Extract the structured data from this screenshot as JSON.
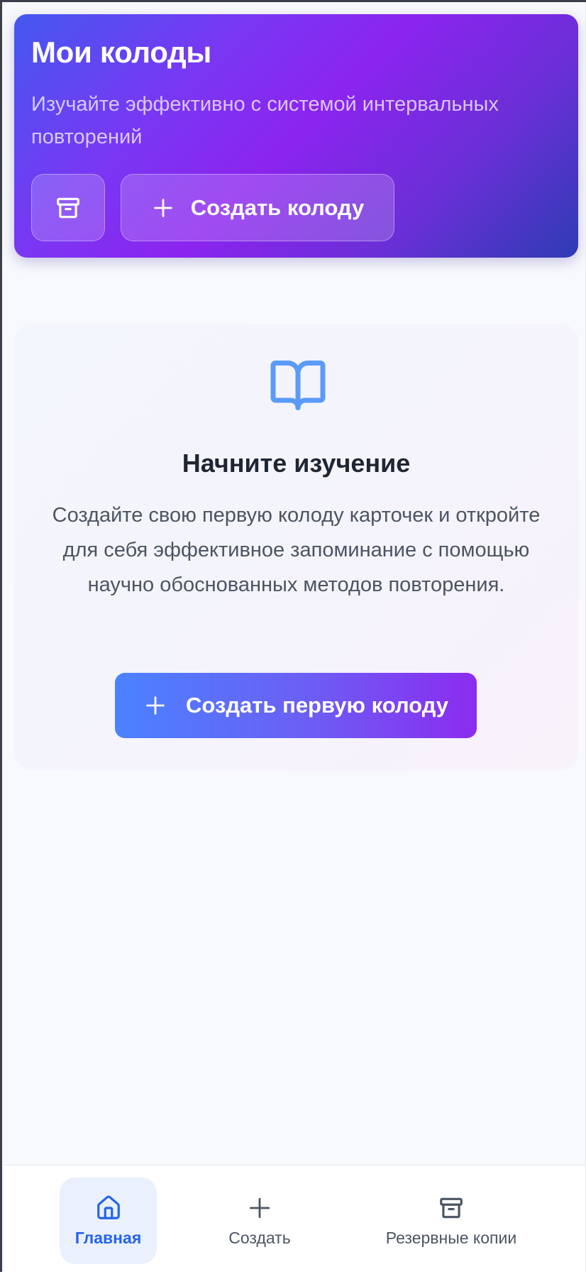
{
  "header": {
    "title": "Мои колоды",
    "subtitle": "Изучайте эффективно с системой интервальных повторений",
    "archive_icon": "archive-icon",
    "create_button_label": "Создать колоду",
    "create_icon": "plus-icon"
  },
  "empty_state": {
    "icon": "book-open-icon",
    "title": "Начните изучение",
    "text": "Создайте свою первую колоду карточек и откройте для себя эффективное запоминание с помощью научно обоснованных методов повторения.",
    "button_label": "Создать первую колоду",
    "button_icon": "plus-icon"
  },
  "bottom_nav": {
    "items": [
      {
        "label": "Главная",
        "icon": "home-icon",
        "active": true
      },
      {
        "label": "Создать",
        "icon": "plus-icon",
        "active": false
      },
      {
        "label": "Резервные копии",
        "icon": "archive-icon",
        "active": false
      }
    ]
  },
  "colors": {
    "accent_blue": "#2563eb",
    "accent_purple": "#8b24ef",
    "background": "#f8f9fc"
  }
}
